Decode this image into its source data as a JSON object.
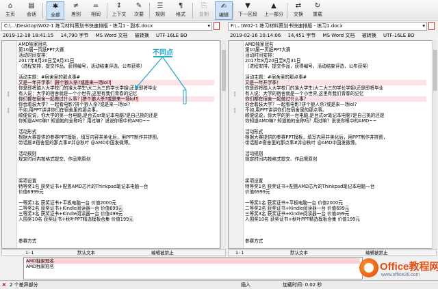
{
  "toolbar": {
    "items": [
      {
        "label": "主页",
        "icon": "home-icon",
        "glyph": "⌂"
      },
      {
        "label": "会话",
        "icon": "session-icon",
        "glyph": "▤"
      },
      {
        "label": "全部",
        "icon": "all-icon",
        "glyph": "✱"
      },
      {
        "label": "差别",
        "icon": "diff-icon",
        "glyph": "≠"
      },
      {
        "label": "相同",
        "icon": "same-icon",
        "glyph": "="
      },
      {
        "label": "上下文",
        "icon": "context-icon",
        "glyph": "⇕"
      },
      {
        "label": "次要",
        "icon": "minor-icon",
        "glyph": "✎"
      },
      {
        "label": "规则",
        "icon": "rules-icon",
        "glyph": "☰"
      },
      {
        "label": "格式",
        "icon": "format-icon",
        "glyph": "¶"
      },
      {
        "label": "复制",
        "icon": "copy-icon",
        "glyph": "⎘"
      },
      {
        "label": "编辑",
        "icon": "edit-icon",
        "glyph": "✍"
      },
      {
        "label": "下一区段",
        "icon": "next-section-icon",
        "glyph": "▼"
      },
      {
        "label": "上一部分",
        "icon": "prev-section-icon",
        "glyph": "▲"
      },
      {
        "label": "交换",
        "icon": "swap-icon",
        "glyph": "⇄"
      },
      {
        "label": "重载",
        "icon": "reload-icon",
        "glyph": "↻"
      }
    ]
  },
  "left": {
    "path": "C:\\...\\Desktop\\W02-1 练习材料策划书快速排版 - 练习1 - 副本.docx",
    "date": "2019-12-18 18:41:15",
    "size": "14,790 字节",
    "format": "MS Word 文档",
    "convert": "被转换",
    "encoding": "UTF-16LE BO",
    "status_pos": "1: 1",
    "status_mode": "默认文本",
    "status_edit": "编辑被禁止",
    "lines": [
      "AMD独家冠名",
      "第10届一页纸PPT大赛",
      "活动时间安排：",
      "2017年8月20日至8月31日",
      "（进程安排，提交作品，获得编号，活动结束评选，公布获奖）",
      "",
      "活动主题：#宿舍里的那点事#",
      "又是一年开学季！拼个狼人杀?或是来一场lol?",
      "你是即将踏入大学校门的准大学生\\大二大三的学长学姐\\还是即将毕业",
      "有人说：大学的宿舍就是一个小世界,这里有我们青春的记忆",
      "你们都在宿舍一起做过什么事？拼个狼人杀?或是来一场lol?",
      "你会着装大学？一起看电影?拼个狼人杀?或是来一场lol?",
      "不如,用PPT讲讲你们在宿舍里的那点事。",
      "顺便说说，你大学的第一台电脑,是台式or笔记本电脑?是自己挑的还是",
      "你知道AMD嘛? 知道她的全称吗？用过嘛？说说你眼中的AMD~~",
      "",
      "活动形式",
      "根据大赛提供的参赛PPT模板，填写内容并美化后，用PPT制作并拼图，",
      "带话题#宿舍里的那点事#并@秋叶 @AMD中国发微博。",
      "",
      "活动规则",
      "规定时间内按格式提交、作品需原创",
      "",
      "",
      "",
      "奖项设置",
      "特等奖1名   获奖证书+配置AMD芯片的Thinkpad笔记本电脑一台",
      "价值6999元",
      "",
      "一等奖1名   获奖证书+平板电脑一台   价值2000元",
      "二等奖2名   获奖证书+Kindle阅读器一台   价值699元",
      "三等奖3名   获奖证书+Kindle阅读器一台   价值499元",
      "入围奖10名   获奖证书+秋叶PPT精选模板合集   价值199元",
      "",
      "",
      "",
      "参赛方式"
    ]
  },
  "right": {
    "path": "F:\\...\\W02-1 练习材料策划书快速排版 - 练习1.docx",
    "date": "2019-02-16 10:14:06",
    "size": "14,451 字节",
    "format": "MS Word 文档",
    "convert": "被转换",
    "encoding": "UTF-16LE BO",
    "status_pos": "1: 1",
    "status_mode": "默认文本",
    "status_edit": "编辑被禁止",
    "lines": [
      "AMD独家冠名",
      "第10届一页纸PPT大赛",
      "活动时间安排：",
      "2017年8月20日至8月31日",
      "（进程安排，提交作品，获得编号，活动结束评选，公布获奖）",
      "",
      "活动主题：#宿舍里的那点事#",
      "又是一年开学季！",
      "你是即将踏入大学校门的准大学生\\大二大三的学长学姐\\还是即将毕业",
      "有人说：大学的宿舍就是一个小世界,这里有我们青春的记忆",
      "你们都在宿舍一起做过什么事？",
      "你会着装大学？一起看电影?拼个狼人杀?或是来一场lol?",
      "不如,用PPT讲讲你们在宿舍里的那点事。",
      "顺便说说，你大学的第一台电脑,是台式or笔记本电脑?是自己挑的还是",
      "你知道AMD嘛? 知道她的全称吗？用过嘛？说说你眼中的AMD~~",
      "",
      "活动形式",
      "根据大赛提供的参赛PPT模板，填写内容并美化后，用PPT制作并拼图，",
      "带话题#宿舍里的那点事#并@秋叶 @AMD中国发微博。",
      "",
      "活动规则",
      "规定时间内按格式提交、作品需原创",
      "",
      "",
      "",
      "奖项设置",
      "特等奖1名   获奖证书+配置AMD芯片的Thinkpad笔记本电脑一台",
      "价值6999元",
      "",
      "一等奖1名   获奖证书+平板电脑一台   价值2000元",
      "二等奖2名   获奖证书+Kindle阅读器一台   价值699元",
      "三等奖3名   获奖证书+Kindle阅读器一台   价值499元",
      "入围奖10名   获奖证书+秋叶PPT精选模板合集   价值199元",
      "",
      "",
      "",
      "参赛方式"
    ]
  },
  "annotation": {
    "label": "不同点",
    "color": "#2aa7c9"
  },
  "preview": {
    "line1": "AMD独家冠名",
    "line2": "AMD独家冠名"
  },
  "statusbar": {
    "diff_count": "2 个差异部分",
    "insert": "插入",
    "load_time": "加载时间: 0.02 秒"
  },
  "watermark": {
    "name": "Office教程网",
    "url": "www.office26.com"
  }
}
